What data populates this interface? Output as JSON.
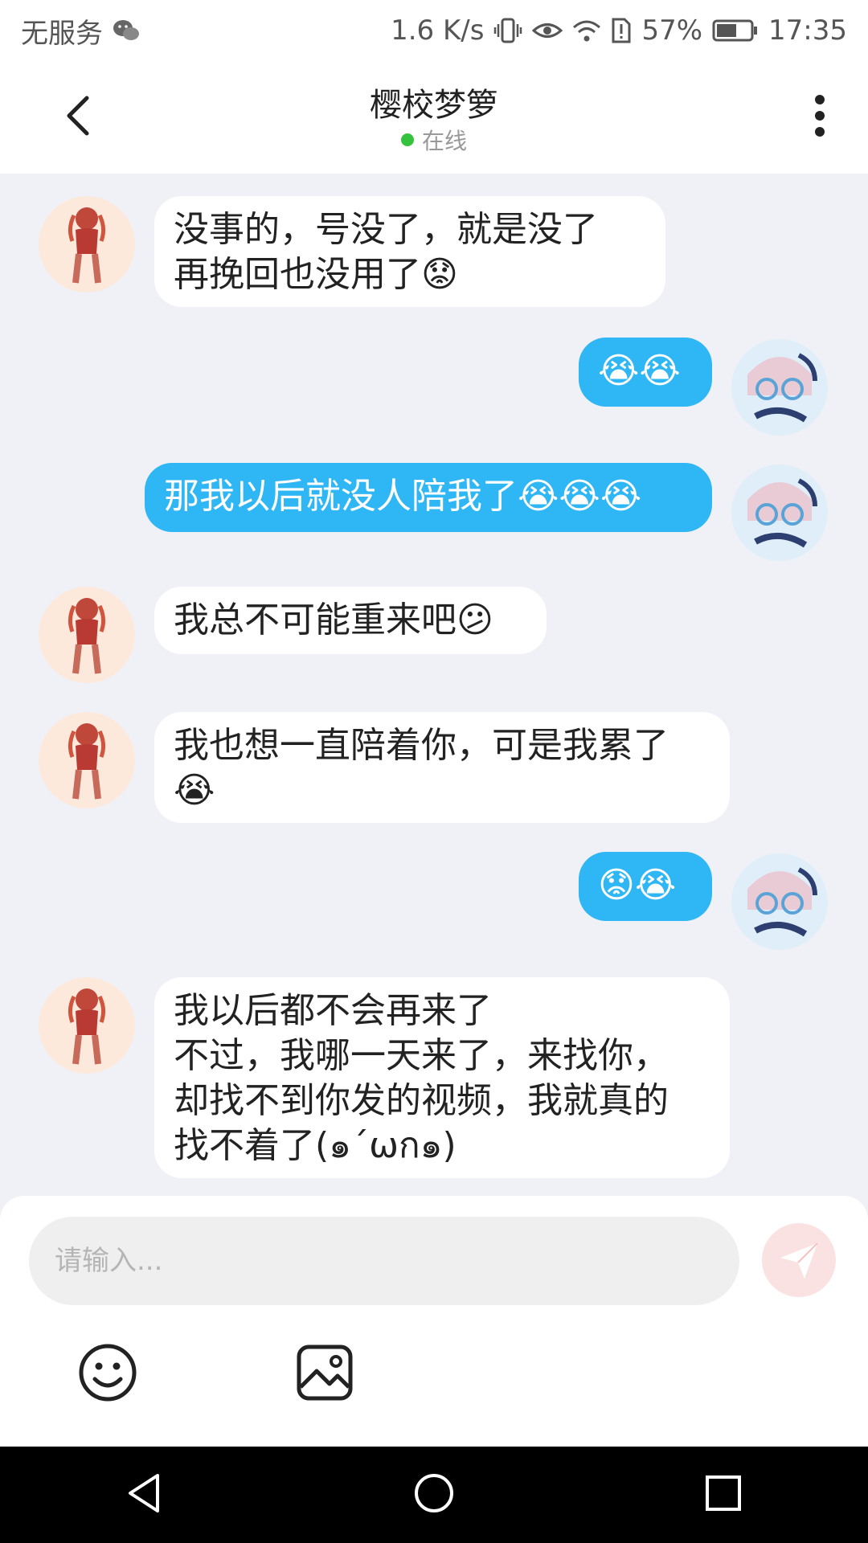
{
  "status_bar": {
    "carrier": "无服务",
    "network_speed": "1.6 K/s",
    "battery": "57%",
    "time": "17:35"
  },
  "header": {
    "title": "樱校梦箩",
    "status": "在线"
  },
  "messages": [
    {
      "side": "in",
      "text": "没事的，号没了，就是没了\n再挽回也没用了😟"
    },
    {
      "side": "out",
      "text": "😭😭"
    },
    {
      "side": "out",
      "text": "那我以后就没人陪我了😭😭😭"
    },
    {
      "side": "in",
      "text": "我总不可能重来吧😕"
    },
    {
      "side": "in",
      "text": "我也想一直陪着你，可是我累了\n😭"
    },
    {
      "side": "out",
      "text": "😟😭"
    },
    {
      "side": "in",
      "text": "我以后都不会再来了\n不过，我哪一天来了，来找你，\n却找不到你发的视频，我就真的\n找不着了(๑´ωก๑)"
    }
  ],
  "input": {
    "placeholder": "请输入..."
  },
  "icons": {
    "wechat": "wechat-icon",
    "vibrate": "vibrate-icon",
    "eye": "eye-icon",
    "wifi": "wifi-icon",
    "sim": "sim-alert-icon",
    "battery": "battery-icon",
    "back": "back-arrow-icon",
    "more": "more-vertical-icon",
    "send": "send-icon",
    "emoji": "emoji-icon",
    "image": "image-icon",
    "nav_back": "nav-back-icon",
    "nav_home": "nav-home-icon",
    "nav_recent": "nav-recent-icon"
  },
  "colors": {
    "outgoing_bubble": "#2fb6f4",
    "incoming_bubble": "#ffffff",
    "online_dot": "#35c23c",
    "send_button": "#fbe2e2"
  }
}
